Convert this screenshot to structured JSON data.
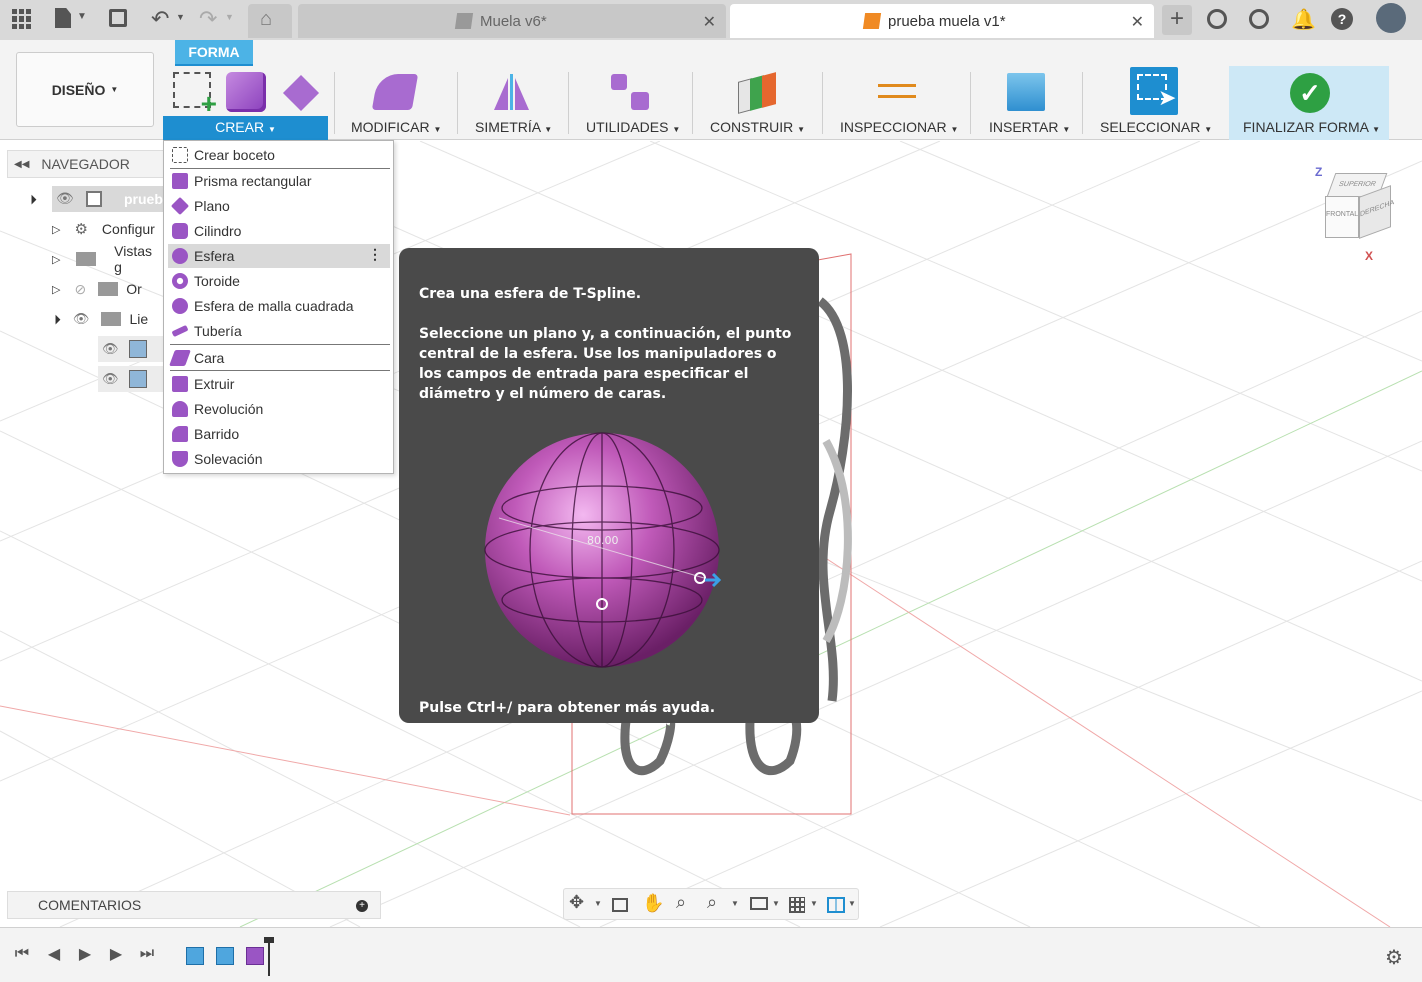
{
  "tabs": {
    "inactive": "Muela v6*",
    "active": "prueba muela v1*"
  },
  "ribbon": {
    "workspace": "DISEÑO",
    "tab": "FORMA",
    "groups": [
      "CREAR",
      "MODIFICAR",
      "SIMETRÍA",
      "UTILIDADES",
      "CONSTRUIR",
      "INSPECCIONAR",
      "INSERTAR",
      "SELECCIONAR",
      "FINALIZAR FORMA"
    ]
  },
  "navigator": {
    "title": "NAVEGADOR",
    "items": [
      "prueb",
      "Configur",
      "Vistas g",
      "Or",
      "Lie"
    ]
  },
  "menu": {
    "items": [
      "Crear boceto",
      "Prisma rectangular",
      "Plano",
      "Cilindro",
      "Esfera",
      "Toroide",
      "Esfera de malla cuadrada",
      "Tubería",
      "Cara",
      "Extruir",
      "Revolución",
      "Barrido",
      "Solevación"
    ]
  },
  "tooltip": {
    "title": "Crea una esfera de T-Spline.",
    "body": "Seleccione un plano y, a continuación, el punto central de la esfera. Use los manipuladores o los campos de entrada para especificar el diámetro y el número de caras.",
    "dimension": "80.00",
    "help": "Pulse Ctrl+/ para obtener más ayuda."
  },
  "viewcube": {
    "top": "SUPERIOR",
    "front": "FRONTAL",
    "right": "DERECHA",
    "z": "Z",
    "x": "X"
  },
  "comments": "COMENTARIOS"
}
